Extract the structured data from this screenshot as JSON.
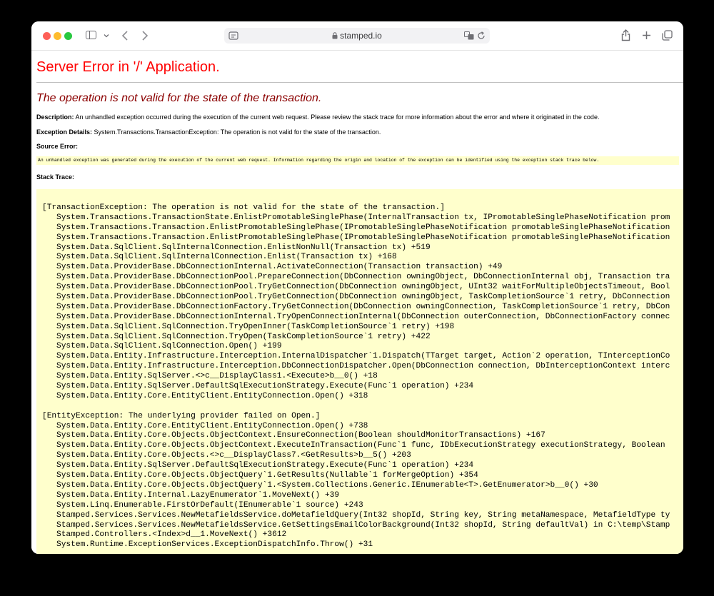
{
  "browser": {
    "url": "stamped.io",
    "icons": [
      "sidebar-icon",
      "chevron-down-icon",
      "back-icon",
      "forward-icon",
      "page-settings-icon",
      "lock-icon",
      "translate-icon",
      "reload-icon",
      "share-icon",
      "new-tab-icon",
      "tabs-overview-icon"
    ]
  },
  "page": {
    "title": "Server Error in '/' Application.",
    "subtitle": "The operation is not valid for the state of the transaction.",
    "description_label": "Description:",
    "description_text": " An unhandled exception occurred during the execution of the current web request. Please review the stack trace for more information about the error and where it originated in the code.",
    "exception_label": "Exception Details:",
    "exception_text": " System.Transactions.TransactionException: The operation is not valid for the state of the transaction.",
    "source_error_label": "Source Error:",
    "source_error_text": "An unhandled exception was generated during the execution of the current web request. Information regarding the origin and location of the exception can be identified using the exception stack trace below.",
    "stack_trace_label": "Stack Trace:",
    "stack_blocks": [
      {
        "header": "[TransactionException: The operation is not valid for the state of the transaction.]",
        "lines": [
          "System.Transactions.TransactionState.EnlistPromotableSinglePhase(InternalTransaction tx, IPromotableSinglePhaseNotification prom",
          "System.Transactions.Transaction.EnlistPromotableSinglePhase(IPromotableSinglePhaseNotification promotableSinglePhaseNotification",
          "System.Transactions.Transaction.EnlistPromotableSinglePhase(IPromotableSinglePhaseNotification promotableSinglePhaseNotification",
          "System.Data.SqlClient.SqlInternalConnection.EnlistNonNull(Transaction tx) +519",
          "System.Data.SqlClient.SqlInternalConnection.Enlist(Transaction tx) +168",
          "System.Data.ProviderBase.DbConnectionInternal.ActivateConnection(Transaction transaction) +49",
          "System.Data.ProviderBase.DbConnectionPool.PrepareConnection(DbConnection owningObject, DbConnectionInternal obj, Transaction tra",
          "System.Data.ProviderBase.DbConnectionPool.TryGetConnection(DbConnection owningObject, UInt32 waitForMultipleObjectsTimeout, Bool",
          "System.Data.ProviderBase.DbConnectionPool.TryGetConnection(DbConnection owningObject, TaskCompletionSource`1 retry, DbConnection",
          "System.Data.ProviderBase.DbConnectionFactory.TryGetConnection(DbConnection owningConnection, TaskCompletionSource`1 retry, DbCon",
          "System.Data.ProviderBase.DbConnectionInternal.TryOpenConnectionInternal(DbConnection outerConnection, DbConnectionFactory connec",
          "System.Data.SqlClient.SqlConnection.TryOpenInner(TaskCompletionSource`1 retry) +198",
          "System.Data.SqlClient.SqlConnection.TryOpen(TaskCompletionSource`1 retry) +422",
          "System.Data.SqlClient.SqlConnection.Open() +199",
          "System.Data.Entity.Infrastructure.Interception.InternalDispatcher`1.Dispatch(TTarget target, Action`2 operation, TInterceptionCo",
          "System.Data.Entity.Infrastructure.Interception.DbConnectionDispatcher.Open(DbConnection connection, DbInterceptionContext interc",
          "System.Data.Entity.SqlServer.<>c__DisplayClass1.<Execute>b__0() +18",
          "System.Data.Entity.SqlServer.DefaultSqlExecutionStrategy.Execute(Func`1 operation) +234",
          "System.Data.Entity.Core.EntityClient.EntityConnection.Open() +318"
        ]
      },
      {
        "header": "[EntityException: The underlying provider failed on Open.]",
        "lines": [
          "System.Data.Entity.Core.EntityClient.EntityConnection.Open() +738",
          "System.Data.Entity.Core.Objects.ObjectContext.EnsureConnection(Boolean shouldMonitorTransactions) +167",
          "System.Data.Entity.Core.Objects.ObjectContext.ExecuteInTransaction(Func`1 func, IDbExecutionStrategy executionStrategy, Boolean",
          "System.Data.Entity.Core.Objects.<>c__DisplayClass7.<GetResults>b__5() +203",
          "System.Data.Entity.SqlServer.DefaultSqlExecutionStrategy.Execute(Func`1 operation) +234",
          "System.Data.Entity.Core.Objects.ObjectQuery`1.GetResults(Nullable`1 forMergeOption) +354",
          "System.Data.Entity.Core.Objects.ObjectQuery`1.<System.Collections.Generic.IEnumerable<T>.GetEnumerator>b__0() +30",
          "System.Data.Entity.Internal.LazyEnumerator`1.MoveNext() +39",
          "System.Linq.Enumerable.FirstOrDefault(IEnumerable`1 source) +243",
          "Stamped.Services.Services.NewMetafieldsService.doMetafieldQuery(Int32 shopId, String key, String metaNamespace, MetafieldType ty",
          "Stamped.Services.Services.NewMetafieldsService.GetSettingsEmailColorBackground(Int32 shopId, String defaultVal) in C:\\temp\\Stamp",
          "Stamped.Controllers.<Index>d__1.MoveNext() +3612",
          "System.Runtime.ExceptionServices.ExceptionDispatchInfo.Throw() +31"
        ]
      }
    ]
  },
  "colors": {
    "title_red": "#ff0000",
    "subtitle_darkred": "#8b0000",
    "code_background": "#ffffcc"
  }
}
